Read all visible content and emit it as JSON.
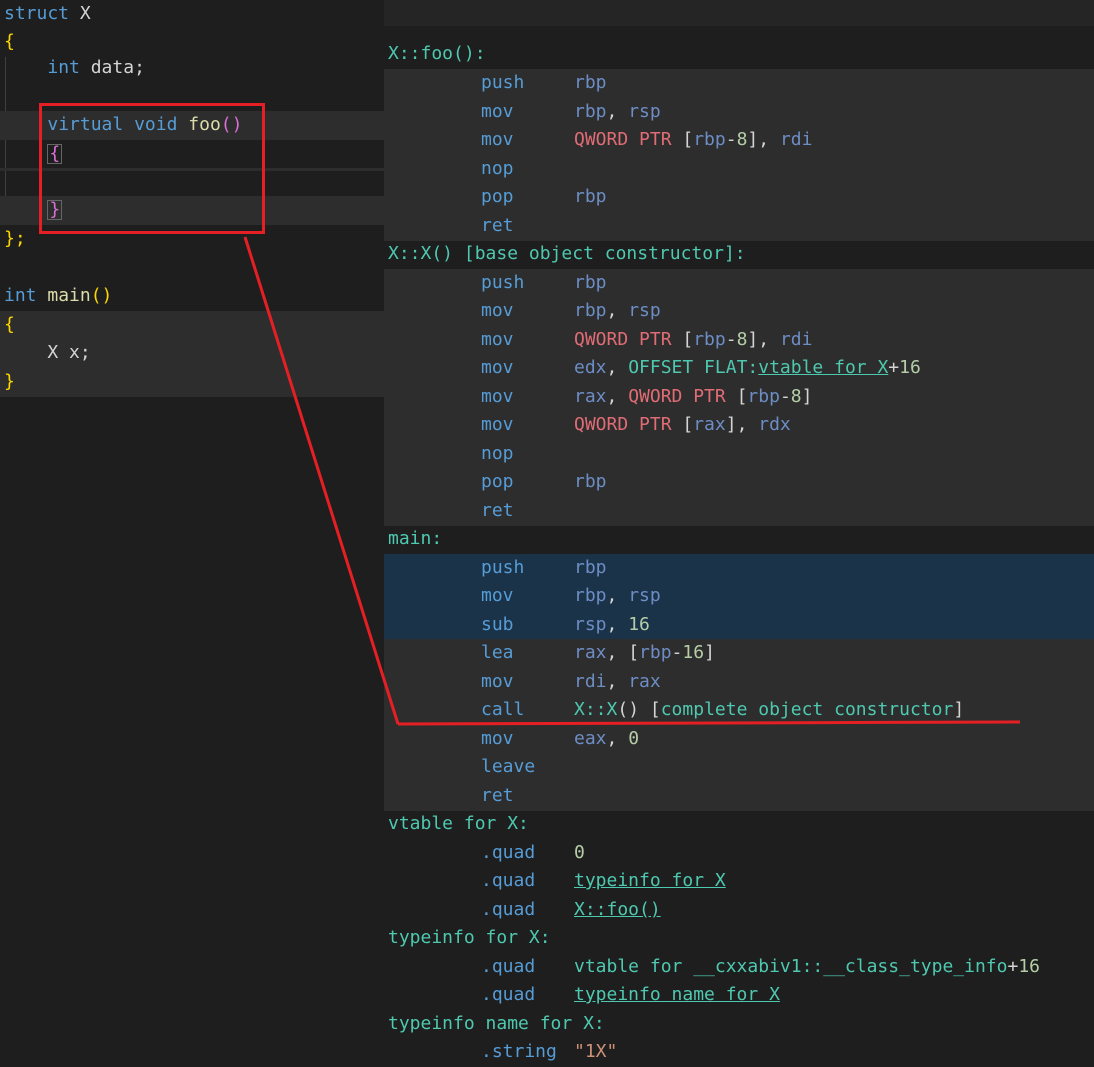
{
  "source": {
    "lines": {
      "struct_kw": "struct",
      "struct_name": "X",
      "open_brace": "{",
      "member_type": "int",
      "member_name": "data;",
      "virtual_kw": "virtual",
      "void_kw": "void",
      "method_name": "foo",
      "parens": "()",
      "fn_open": "{",
      "fn_close": "}",
      "struct_close": "};",
      "main_type": "int",
      "main_name": "main",
      "main_parens": "()",
      "main_open": "{",
      "var_decl": "X x;",
      "main_close": "}"
    }
  },
  "asm": {
    "foo_label": "X::foo():",
    "foo_body": [
      {
        "op": "push",
        "args": "rbp"
      },
      {
        "op": "mov",
        "args": "rbp, rsp"
      },
      {
        "op": "mov",
        "args": "QWORD PTR [rbp-8], rdi"
      },
      {
        "op": "nop",
        "args": ""
      },
      {
        "op": "pop",
        "args": "rbp"
      },
      {
        "op": "ret",
        "args": ""
      }
    ],
    "ctor_label": "X::X() [base object constructor]:",
    "ctor_body": [
      {
        "op": "push",
        "args": "rbp"
      },
      {
        "op": "mov",
        "args": "rbp, rsp"
      },
      {
        "op": "mov",
        "args": "QWORD PTR [rbp-8], rdi"
      },
      {
        "op": "mov",
        "args": "edx, OFFSET FLAT:vtable for X+16"
      },
      {
        "op": "mov",
        "args": "rax, QWORD PTR [rbp-8]"
      },
      {
        "op": "mov",
        "args": "QWORD PTR [rax], rdx"
      },
      {
        "op": "nop",
        "args": ""
      },
      {
        "op": "pop",
        "args": "rbp"
      },
      {
        "op": "ret",
        "args": ""
      }
    ],
    "main_label": "main:",
    "main_body": [
      {
        "op": "push",
        "args": "rbp"
      },
      {
        "op": "mov",
        "args": "rbp, rsp"
      },
      {
        "op": "sub",
        "args": "rsp, 16"
      },
      {
        "op": "lea",
        "args": "rax, [rbp-16]"
      },
      {
        "op": "mov",
        "args": "rdi, rax"
      },
      {
        "op": "call",
        "args": "X::X() [complete object constructor]"
      },
      {
        "op": "mov",
        "args": "eax, 0"
      },
      {
        "op": "leave",
        "args": ""
      },
      {
        "op": "ret",
        "args": ""
      }
    ],
    "vtable_label": "vtable for X:",
    "vtable_body": [
      {
        "op": ".quad",
        "args": "0"
      },
      {
        "op": ".quad",
        "args": "typeinfo for X"
      },
      {
        "op": ".quad",
        "args": "X::foo()"
      }
    ],
    "typeinfo_label": "typeinfo for X:",
    "typeinfo_body": [
      {
        "op": ".quad",
        "args": "vtable for __cxxabiv1::__class_type_info+16"
      },
      {
        "op": ".quad",
        "args": "typeinfo name for X"
      }
    ],
    "typeinfo_name_label": "typeinfo name for X:",
    "typeinfo_name_body": [
      {
        "op": ".string",
        "args": "\"1X\""
      }
    ]
  },
  "colors": {
    "annotation": "#e51f24",
    "highlight_blue": "#1b3349",
    "highlight_gray": "#2d2d2d"
  }
}
